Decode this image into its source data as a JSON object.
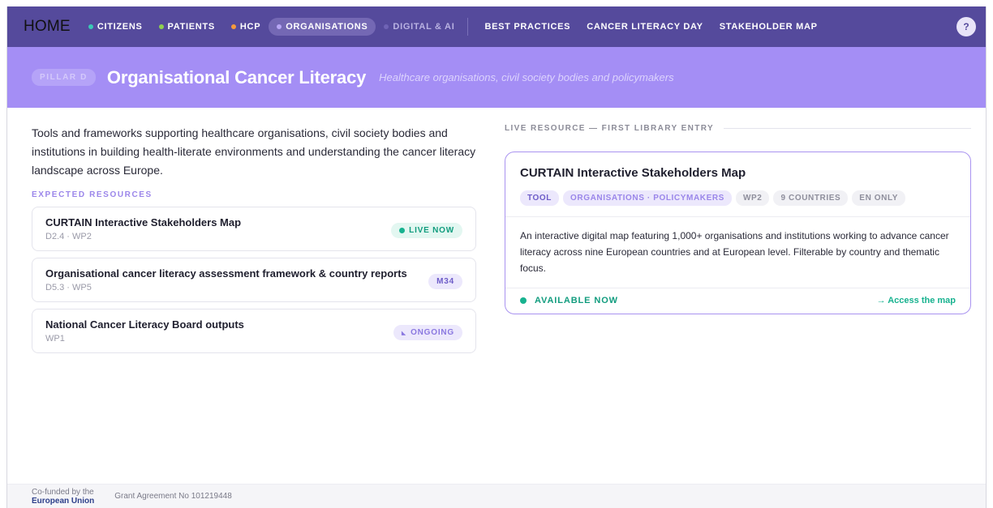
{
  "nav": {
    "home": "HOME",
    "items": [
      {
        "label": "CITIZENS",
        "dot": "#3bc9b5"
      },
      {
        "label": "PATIENTS",
        "dot": "#8fd14f"
      },
      {
        "label": "HCP",
        "dot": "#f59a3b"
      },
      {
        "label": "ORGANISATIONS",
        "dot": "#b7a6f5"
      },
      {
        "label": "DIGITAL & AI",
        "dot": "#6f63b5"
      }
    ],
    "links": [
      "BEST PRACTICES",
      "CANCER LITERACY DAY",
      "STAKEHOLDER MAP"
    ],
    "help": "?"
  },
  "pillar": {
    "tag": "PILLAR D",
    "title": "Organisational Cancer Literacy",
    "subtitle": "Healthcare organisations, civil society bodies and policymakers"
  },
  "left": {
    "intro": "Tools and frameworks supporting healthcare organisations, civil society bodies and institutions in building health-literate environments and understanding the cancer literacy landscape across Europe.",
    "section_label": "EXPECTED RESOURCES",
    "resources": [
      {
        "title": "CURTAIN Interactive Stakeholders Map",
        "meta": "D2.4 · WP2",
        "badge": "LIVE NOW"
      },
      {
        "title": "Organisational cancer literacy assessment framework & country reports",
        "meta": "D5.3 · WP5",
        "badge": "M34"
      },
      {
        "title": "National Cancer Literacy Board outputs",
        "meta": "WP1",
        "badge": "ONGOING"
      }
    ]
  },
  "right": {
    "label": "LIVE RESOURCE — FIRST LIBRARY ENTRY",
    "card": {
      "title": "CURTAIN Interactive Stakeholders Map",
      "tags": [
        "TOOL",
        "ORGANISATIONS · POLICYMAKERS",
        "WP2",
        "9 COUNTRIES",
        "EN ONLY"
      ],
      "description": "An interactive digital map featuring 1,000+ organisations and institutions working to advance cancer literacy across nine European countries and at European level. Filterable by country and thematic focus.",
      "status": "AVAILABLE NOW",
      "link": "→ Access the map"
    }
  },
  "footer": {
    "cofunded_line1": "Co-funded by the",
    "cofunded_line2": "European Union",
    "grant": "Grant Agreement No 101219448"
  },
  "colors": {
    "nav_bg": "#554a9c",
    "pillar_bg": "#a48ef5",
    "accent_green": "#17b28f",
    "card_border": "#a993f0"
  }
}
